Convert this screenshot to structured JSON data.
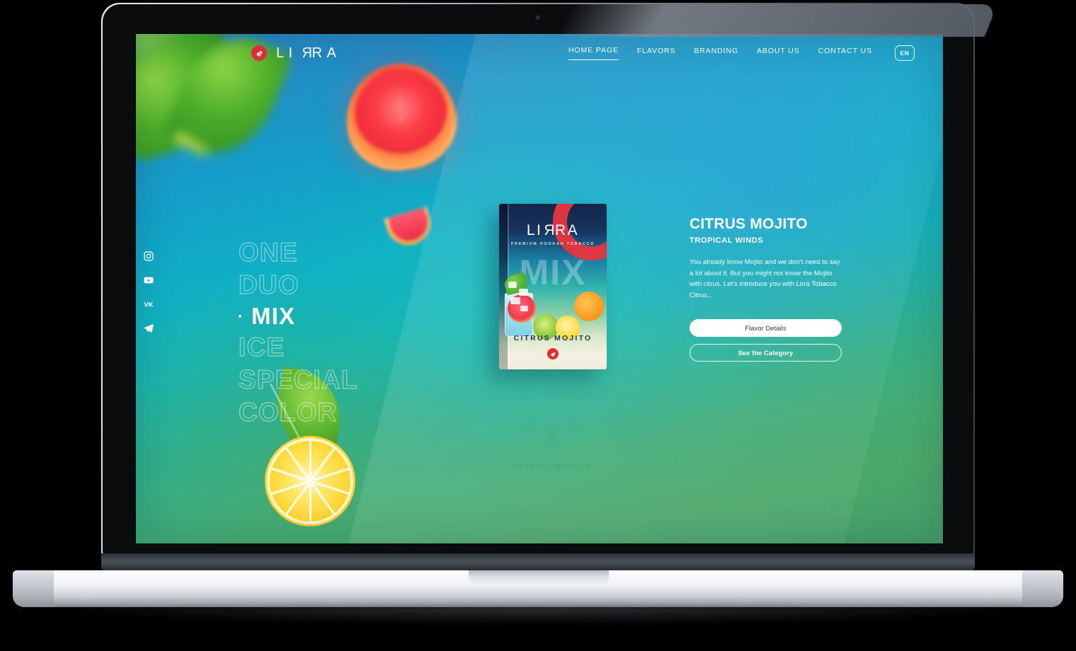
{
  "device": {
    "type": "laptop-mockup"
  },
  "header": {
    "brand": {
      "name_before": "LI",
      "name_flip": "R",
      "name_after": "RA",
      "display": "LIЯRA",
      "mark": "triskelion-logo-icon"
    },
    "nav": [
      {
        "label": "HOME PAGE",
        "active": true
      },
      {
        "label": "FLAVORS",
        "active": false
      },
      {
        "label": "BRANDING",
        "active": false
      },
      {
        "label": "ABOUT US",
        "active": false
      },
      {
        "label": "CONTACT US",
        "active": false
      }
    ],
    "language": {
      "label": "EN"
    }
  },
  "social": [
    {
      "name": "instagram-icon"
    },
    {
      "name": "youtube-icon"
    },
    {
      "name": "vk-icon"
    },
    {
      "name": "telegram-icon"
    }
  ],
  "categories": [
    {
      "label": "ONE",
      "active": false
    },
    {
      "label": "DUO",
      "active": false
    },
    {
      "label": "MIX",
      "active": true
    },
    {
      "label": "ICE",
      "active": false
    },
    {
      "label": "SPECIAL",
      "active": false
    },
    {
      "label": "COLOR",
      "active": false
    }
  ],
  "product": {
    "pack": {
      "brand_before": "LI",
      "brand_flip": "R",
      "brand_after": "RA",
      "tagline": "PREMIUM HOOKAH TOBACCO",
      "line": "MIX",
      "flavor": "CITRUS MOJITO"
    },
    "reflection_text": "CITRUS MOJITO"
  },
  "flavor_panel": {
    "title": "CITRUS MOJITO",
    "subtitle": "TROPICAL WINDS",
    "description": "You already know Mojito and we don't need to say a lot about it. But you might not know the Mojito with citrus. Let's introduce you with Lirra Tobacco Citrus...",
    "primary_button": "Flavor Details",
    "secondary_button": "See the Category"
  },
  "theme": {
    "brand_red": "#e32c33",
    "gradient_blue": "#1f8fc6",
    "gradient_teal": "#10b0c4",
    "gradient_green": "#45a06a",
    "text_white": "#ffffff",
    "button_text_dark": "#2b3a42"
  }
}
